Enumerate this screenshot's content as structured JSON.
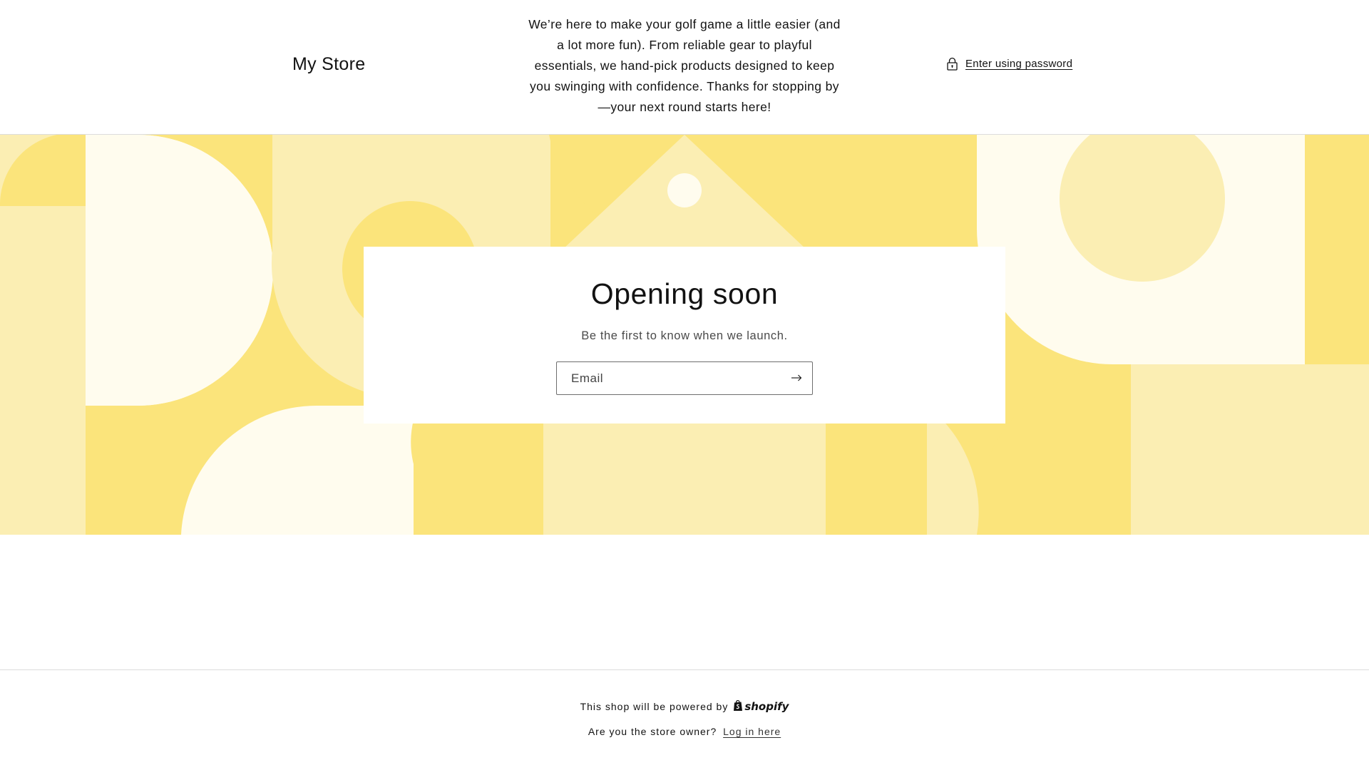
{
  "header": {
    "store_name": "My Store",
    "message": "We’re here to make your golf game a little easier (and a lot more fun). From reliable gear to playful essentials, we hand-pick products designed to keep you swinging with confidence. Thanks for stopping by—your next round starts here!",
    "password_link": "Enter using password",
    "password_icon": "lock-icon"
  },
  "main": {
    "title": "Opening soon",
    "subtitle": "Be the first to know when we launch.",
    "email_placeholder": "Email",
    "submit_icon": "arrow-right-icon"
  },
  "footer": {
    "powered_text": "This shop will be powered by",
    "shopify_logo_text": "shopify",
    "owner_text": "Are you the store owner?",
    "login_link": "Log in here"
  },
  "colors": {
    "banner_yellow": "#fbe47b",
    "banner_light": "#fbeeb3",
    "banner_cream": "#fffcee",
    "text": "#121212",
    "divider": "#dcdcdc"
  }
}
